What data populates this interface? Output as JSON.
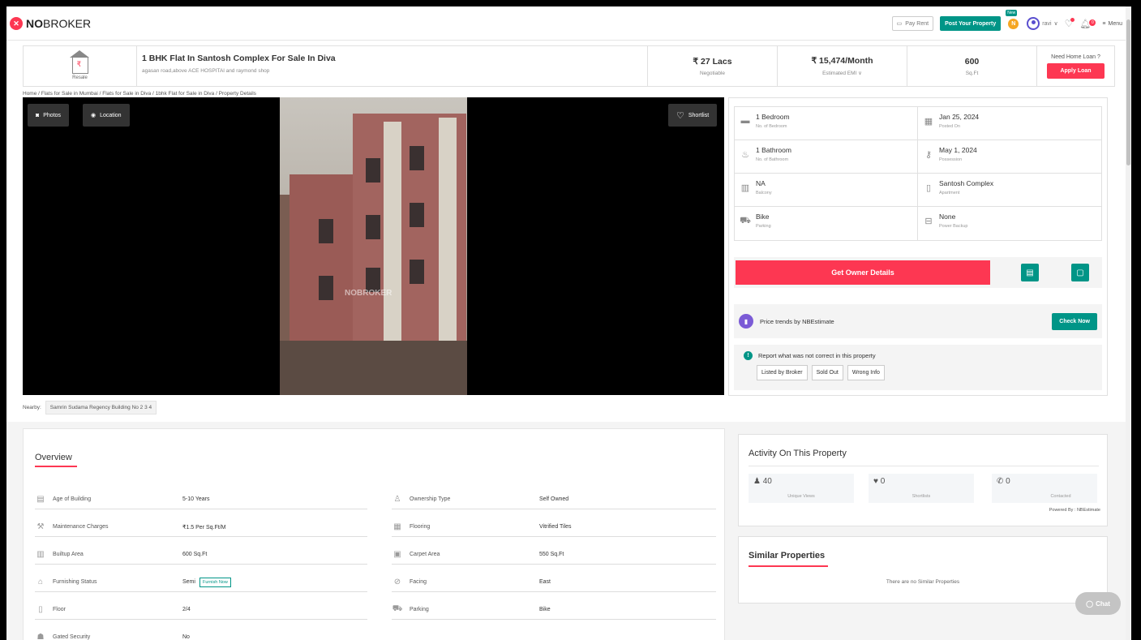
{
  "header": {
    "logo_bold": "NO",
    "logo_rest": "BROKER",
    "pay_rent": "Pay Rent",
    "post_property": "Post Your Property",
    "new_badge": "New",
    "coin": "N",
    "user_name": "ravi",
    "notif_count": "0",
    "menu": "Menu"
  },
  "summary": {
    "tag": "Resale",
    "title": "1 BHK Flat In Santosh Complex For Sale In Diva",
    "address": "agasan road,above ACE HOSPITAl and raymond shop",
    "price": "₹ 27 Lacs",
    "price_note": "Negotiable",
    "emi": "₹ 15,474/Month",
    "emi_note": "Estimated EMI ∨",
    "area": "600",
    "area_unit": "Sq.Ft",
    "loan_q": "Need Home Loan ?",
    "apply_loan": "Apply Loan"
  },
  "breadcrumb": "Home / Flats for Sale in Mumbai / Flats for Sale in Diva / 1bhk Flat for Sale in Diva / Property Details",
  "gallery": {
    "photos": "Photos",
    "location": "Location",
    "shortlist": "Shortlist",
    "watermark": "NOBROKER"
  },
  "nearby": {
    "label": "Nearby:",
    "place": "Samrin Sudama Regency Building No 2 3 4"
  },
  "features": [
    {
      "icon": "bed-icon",
      "value": "1 Bedroom",
      "label": "No. of Bedroom"
    },
    {
      "icon": "calendar-icon",
      "value": "Jan 25, 2024",
      "label": "Posted On"
    },
    {
      "icon": "bathtub-icon",
      "value": "1 Bathroom",
      "label": "No. of Bathroom"
    },
    {
      "icon": "key-icon",
      "value": "May 1, 2024",
      "label": "Possession"
    },
    {
      "icon": "balcony-icon",
      "value": "NA",
      "label": "Balcony"
    },
    {
      "icon": "building-icon",
      "value": "Santosh Complex",
      "label": "Apartment"
    },
    {
      "icon": "car-icon",
      "value": "Bike",
      "label": "Parking"
    },
    {
      "icon": "battery-icon",
      "value": "None",
      "label": "Power Backup"
    }
  ],
  "actions": {
    "owner_details": "Get Owner Details",
    "price_trends": "Price trends by NBEstimate",
    "check_now": "Check Now",
    "report_text": "Report what was not correct in this property",
    "report_buttons": [
      "Listed by Broker",
      "Sold Out",
      "Wrong Info"
    ]
  },
  "overview": {
    "title": "Overview",
    "left": [
      {
        "label": "Age of Building",
        "value": "5-10 Years"
      },
      {
        "label": "Maintenance Charges",
        "value": "₹1.5 Per Sq.Ft/M"
      },
      {
        "label": "Builtup Area",
        "value": "600 Sq.Ft"
      },
      {
        "label": "Furnishing Status",
        "value": "Semi"
      },
      {
        "label": "Floor",
        "value": "2/4"
      },
      {
        "label": "Gated Security",
        "value": "No"
      }
    ],
    "right": [
      {
        "label": "Ownership Type",
        "value": "Self Owned"
      },
      {
        "label": "Flooring",
        "value": "Vitrified Tiles"
      },
      {
        "label": "Carpet Area",
        "value": "550 Sq.Ft"
      },
      {
        "label": "Facing",
        "value": "East"
      },
      {
        "label": "Parking",
        "value": "Bike"
      }
    ],
    "furnish_now": "Furnish Now"
  },
  "activity": {
    "title": "Activity On This Property",
    "views": "40",
    "views_label": "Unique Views",
    "shortlists": "0",
    "shortlists_label": "Shortlists",
    "contacted": "0",
    "contacted_label": "Contacted",
    "powered": "Powered By : NBEstimate"
  },
  "similar": {
    "title": "Similar Properties",
    "empty": "There are no Similar Properties"
  },
  "chat": "Chat",
  "colors": {
    "brand": "#fd3752",
    "accent": "#009587"
  }
}
